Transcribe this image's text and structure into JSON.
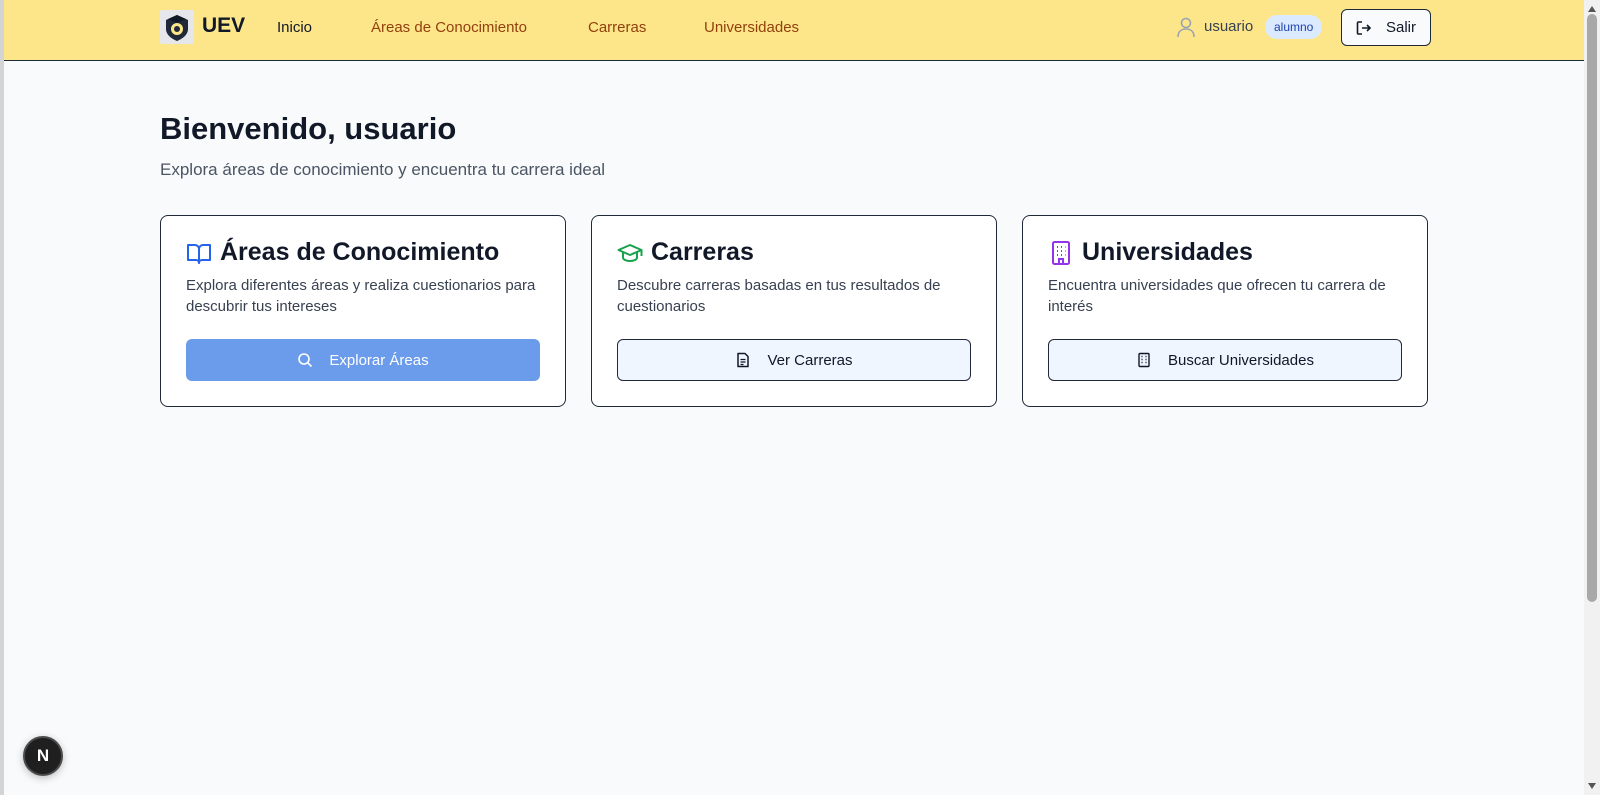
{
  "header": {
    "brand": "UEV",
    "nav": [
      "Inicio",
      "Áreas de Conocimiento",
      "Carreras",
      "Universidades"
    ],
    "active_nav": "Inicio",
    "user_name": "usuario",
    "role_badge": "alumno",
    "logout_label": "Salir"
  },
  "main": {
    "title": "Bienvenido, usuario",
    "subtitle": "Explora áreas de conocimiento y encuentra tu carrera ideal"
  },
  "cards": [
    {
      "icon": "book-open-icon",
      "title": "Áreas de Conocimiento",
      "description": "Explora diferentes áreas y realiza cuestionarios para descubrir tus intereses",
      "button_icon": "search-icon",
      "button_label": "Explorar Áreas"
    },
    {
      "icon": "graduation-cap-icon",
      "title": "Carreras",
      "description": "Descubre carreras basadas en tus resultados de cuestionarios",
      "button_icon": "file-text-icon",
      "button_label": "Ver Carreras"
    },
    {
      "icon": "building-icon",
      "title": "Universidades",
      "description": "Encuentra universidades que ofrecen tu carrera de interés",
      "button_icon": "building-icon",
      "button_label": "Buscar Universidades"
    }
  ],
  "dev_badge": "N",
  "colors": {
    "navbar_bg": "#fde68a",
    "nav_link": "#92400e",
    "primary_button": "#6b9beb",
    "book_icon": "#2563eb",
    "cap_icon": "#16a34a",
    "building_icon": "#9333ea",
    "badge_bg": "#dbeafe"
  }
}
